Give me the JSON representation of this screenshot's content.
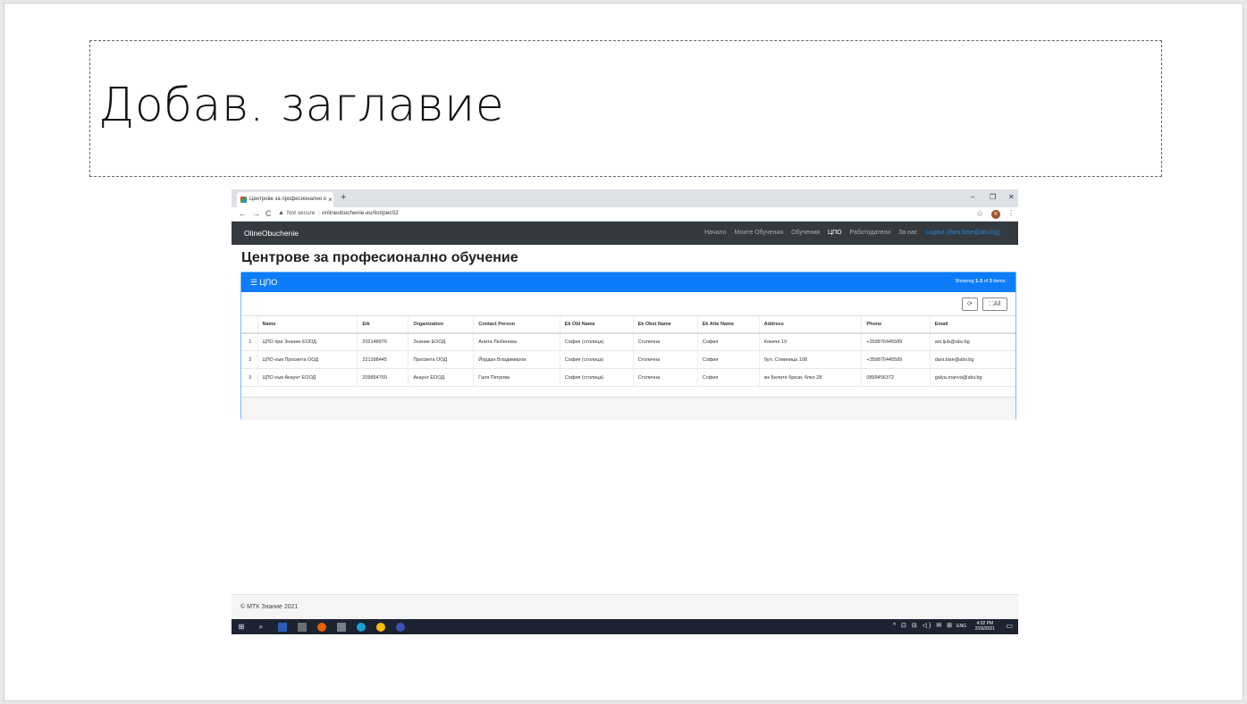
{
  "slide": {
    "title": "Добав. заглавие"
  },
  "browser": {
    "tab_title": "Центрове за професионално о",
    "tab_close": "×",
    "new_tab": "+",
    "window_controls": [
      "–",
      "❐",
      "✕"
    ],
    "security_label": "Not secure",
    "url": "onlineobuchenie.eu/list/pec02",
    "profile_initial": "R"
  },
  "navbar": {
    "brand": "OlineObuchenie",
    "links": [
      "Начало",
      "Моите Обучения",
      "Обучения",
      "ЦПО",
      "Работодатели",
      "За нас"
    ],
    "logout": "Logout (dani.bise@abv.bg)"
  },
  "page": {
    "heading": "Центрове за професионално обучение",
    "panel_title": "ЦПО",
    "summary_prefix": "Showing ",
    "summary_range": "1-3",
    "summary_mid": " of ",
    "summary_total": "3",
    "summary_suffix": " items.",
    "refresh_label": "⟳",
    "all_label": "All"
  },
  "table": {
    "columns": [
      "",
      "Name",
      "Eik",
      "Organization",
      "Contact Person",
      "Ek Obl Name",
      "Ek Obst Name",
      "Ek Atte Name",
      "Address",
      "Phone",
      "Email"
    ],
    "rows": [
      [
        "1",
        "ЦПО при Знание ЕООД",
        "202148976",
        "Знание ЕООД",
        "Анита Любенова",
        "София (столица)",
        "Столична",
        "София",
        "Кокиче 19",
        "+359876445589",
        "ani.ljub@abv.bg"
      ],
      [
        "2",
        "ЦПО към Просвета ООД",
        "221398445",
        "Просвета ООД",
        "Йордан Владимиров",
        "София (столица)",
        "Столична",
        "София",
        "бул. Сливница 108",
        "+359876445589",
        "dani.bise@abv.bg"
      ],
      [
        "3",
        "ЦПО към Акаунт ЕООД",
        "209854760",
        "Акаунт ЕООД",
        "Галя Петрова",
        "София (столица)",
        "Столична",
        "София",
        "жк Белите брези, блко 28",
        "0899456372",
        "galya.mariva@abv.bg"
      ]
    ]
  },
  "footer": {
    "text": "© МТК Знание 2021"
  },
  "taskbar": {
    "lang": "ENG",
    "time": "4:02 PM",
    "date": "2/26/2021",
    "sys_icons": "^ ⊡ ⊟ ◁) ✉ ⊞"
  },
  "colors": {
    "navbar": "#343a40",
    "panel_header": "#0d7cfa",
    "taskbar": "#1c2331"
  }
}
